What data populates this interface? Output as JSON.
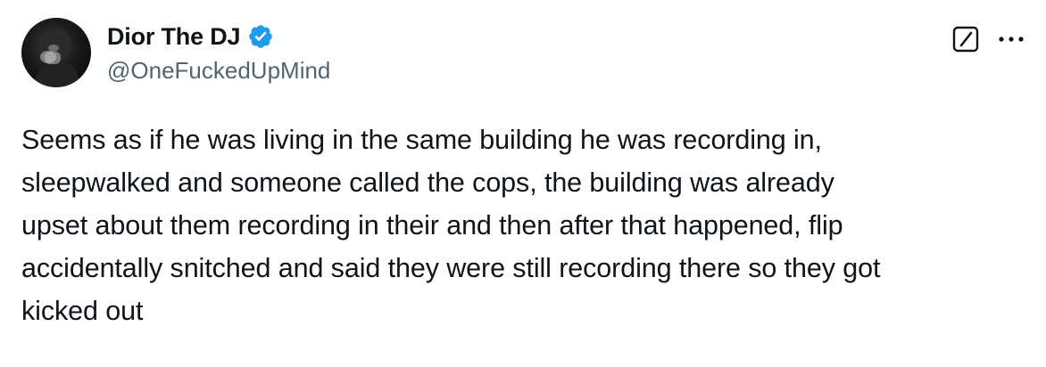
{
  "author": {
    "display_name": "Dior The DJ",
    "handle": "@OneFuckedUpMind",
    "verified": true,
    "avatar_icon": "profile-photo"
  },
  "actions": {
    "edit_icon": "edit-icon",
    "more_icon": "more-options-icon"
  },
  "post": {
    "text": "Seems as if he was living in the same building he was recording in,\nsleepwalked and someone called the cops, the building was already\nupset about them recording in their and then after that happened, flip\naccidentally snitched and said they were still recording there so they got\nkicked out"
  },
  "colors": {
    "text": "#0f1419",
    "secondary": "#536471",
    "verified_badge": "#1d9bf0"
  }
}
